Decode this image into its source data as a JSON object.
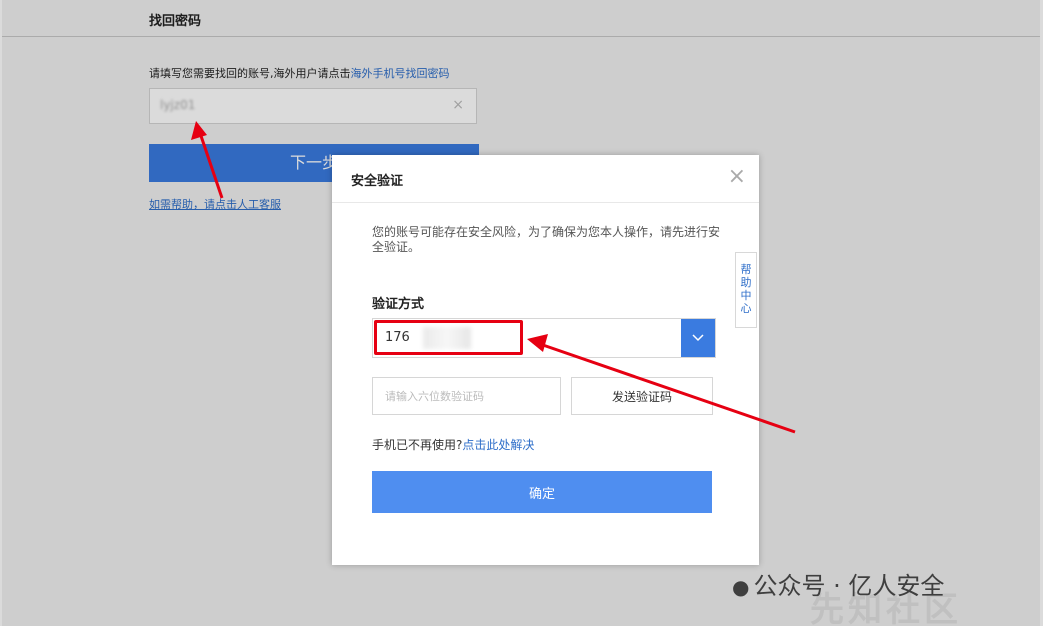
{
  "header": {
    "title": "找回密码"
  },
  "form": {
    "instruction": "请填写您需要找回的账号,海外用户请点击",
    "overseas_link": "海外手机号找回密码",
    "account_value": "lyjz01",
    "clear_icon": "×",
    "next_button": "下一步",
    "help_text": "如需帮助，请点击人工客服"
  },
  "modal": {
    "title": "安全验证",
    "close_icon": "×",
    "warning": "您的账号可能存在安全风险，为了确保为您本人操作，请先进行安全验证。",
    "method_label": "验证方式",
    "selected_value": "176",
    "dropdown_icon": "chevron-down-icon",
    "code_placeholder": "请输入六位数验证码",
    "send_button": "发送验证码",
    "no_phone_text": "手机已不再使用?",
    "no_phone_link": "点击此处解决",
    "confirm_button": "确定"
  },
  "help_center_tab": "帮助中心",
  "watermark": {
    "text": "公众号 · 亿人安全",
    "faint": "先知社区"
  },
  "colors": {
    "accent": "#3a7be0",
    "link": "#2e6ec9",
    "annotation": "#e60012"
  }
}
